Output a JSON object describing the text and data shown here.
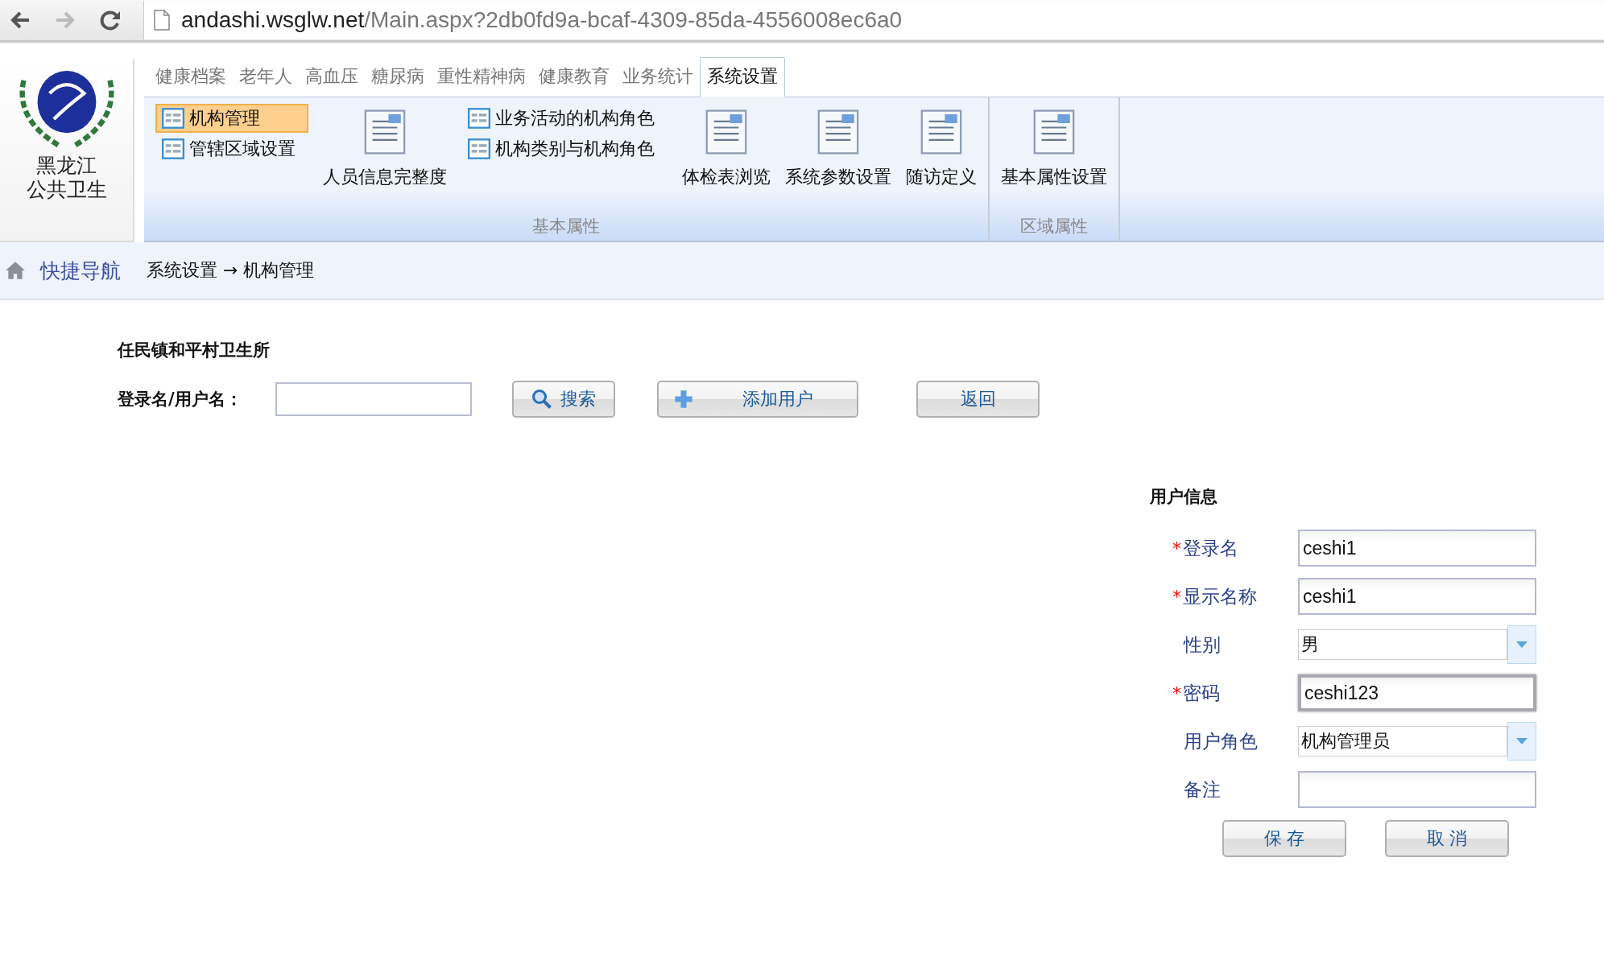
{
  "browser": {
    "url_host": "andashi.wsglw.net",
    "url_path": "/Main.aspx?2db0fd9a-bcaf-4309-85da-4556008ec6a0"
  },
  "logo_lines": [
    "黑龙江",
    "公共卫生"
  ],
  "nav_tabs": [
    {
      "label": "健康档案",
      "selected": false
    },
    {
      "label": "老年人",
      "selected": false
    },
    {
      "label": "高血压",
      "selected": false
    },
    {
      "label": "糖尿病",
      "selected": false
    },
    {
      "label": "重性精神病",
      "selected": false
    },
    {
      "label": "健康教育",
      "selected": false
    },
    {
      "label": "业务统计",
      "selected": false
    },
    {
      "label": "系统设置",
      "selected": true
    }
  ],
  "ribbon_groups": [
    {
      "title": "基本属性",
      "items": [
        {
          "kind": "stack",
          "entries": [
            {
              "label": "机构管理",
              "selected": true
            },
            {
              "label": "管辖区域设置",
              "selected": false
            }
          ]
        },
        {
          "kind": "large",
          "label": "人员信息完整度"
        },
        {
          "kind": "stack",
          "entries": [
            {
              "label": "业务活动的机构角色",
              "selected": false
            },
            {
              "label": "机构类别与机构角色",
              "selected": false
            }
          ]
        },
        {
          "kind": "large",
          "label": "体检表浏览"
        },
        {
          "kind": "large",
          "label": "系统参数设置"
        },
        {
          "kind": "large",
          "label": "随访定义"
        }
      ]
    },
    {
      "title": "区域属性",
      "items": [
        {
          "kind": "large",
          "label": "基本属性设置"
        }
      ]
    }
  ],
  "quick_nav": "快捷导航",
  "breadcrumb": "系统设置 → 机构管理",
  "org_title": "任民镇和平村卫生所",
  "search": {
    "label": "登录名/用户名："
  },
  "search_buttons": [
    {
      "kind": "search",
      "label": "搜索"
    },
    {
      "kind": "add",
      "label": "添加用户"
    },
    {
      "kind": "plain",
      "label": "返回"
    }
  ],
  "user_info": {
    "title": "用户信息",
    "fields": [
      {
        "kind": "text",
        "required_mark": "*",
        "label": "登录名",
        "value": "ceshi1",
        "focused": false
      },
      {
        "kind": "text",
        "required_mark": "*",
        "label": "显示名称",
        "value": "ceshi1",
        "focused": false
      },
      {
        "kind": "select",
        "label": "性别",
        "value": "男",
        "focused": false
      },
      {
        "kind": "text",
        "required_mark": "*",
        "label": "密码",
        "value": "ceshi123",
        "focused": true
      },
      {
        "kind": "select",
        "label": "用户角色",
        "value": "机构管理员",
        "focused": false
      },
      {
        "kind": "text",
        "label": "备注",
        "focused": false
      }
    ],
    "buttons": [
      "保 存",
      "取 消"
    ]
  }
}
